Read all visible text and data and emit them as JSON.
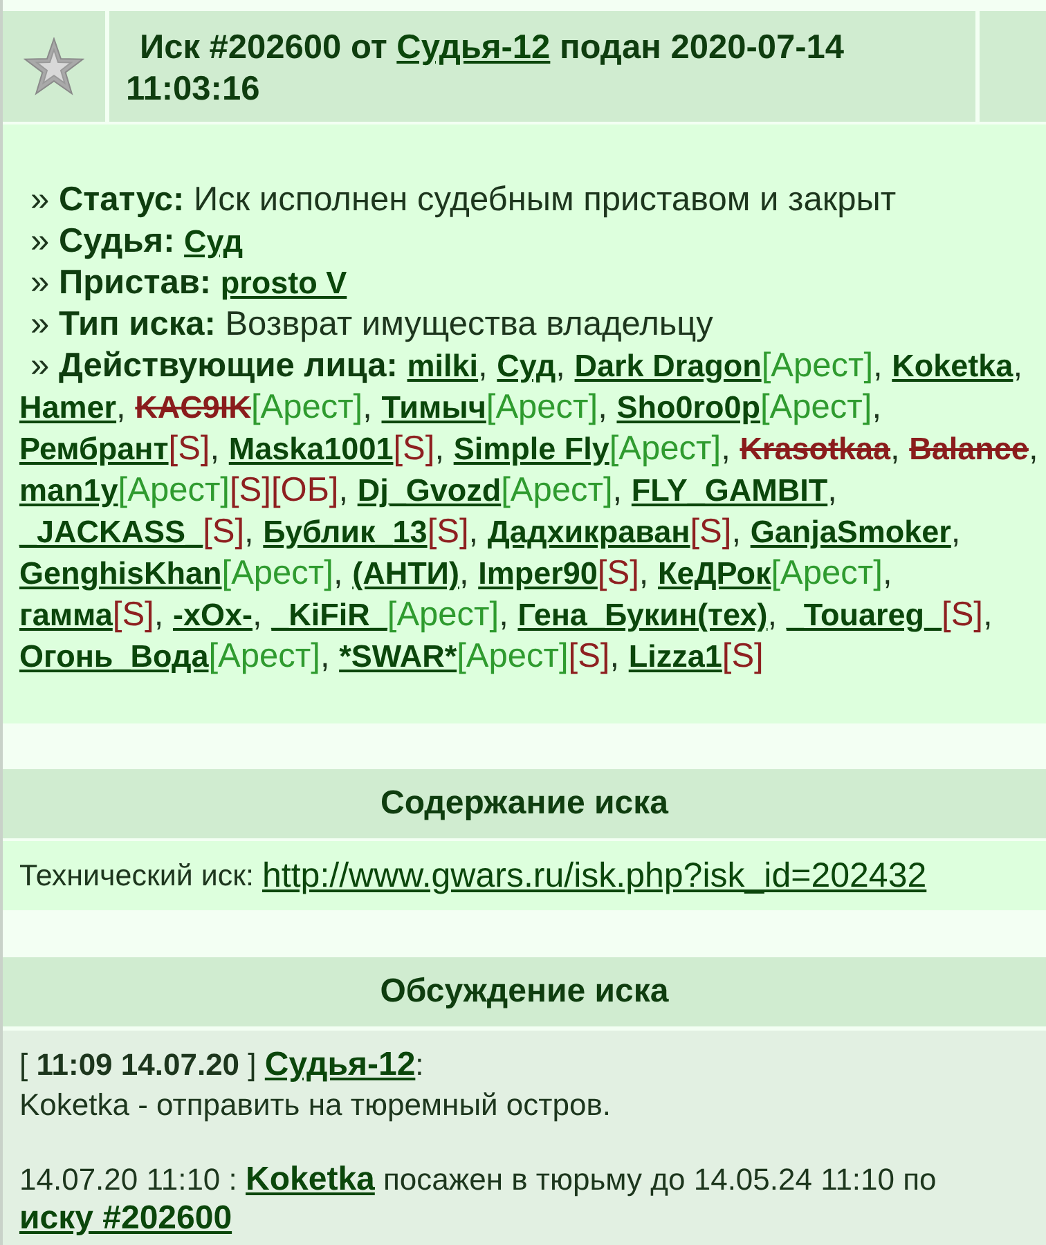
{
  "header": {
    "prefix": "Иск #202600 от",
    "author": "Судья-12",
    "suffix": "подан 2020-07-14 11:03:16"
  },
  "details": [
    {
      "bullet": "»",
      "label": "Статус:",
      "kind": "text",
      "value": "Иск исполнен судебным приставом и закрыт"
    },
    {
      "bullet": "»",
      "label": "Судья:",
      "kind": "link",
      "value": "Суд"
    },
    {
      "bullet": "»",
      "label": "Пристав:",
      "kind": "link",
      "value": "prosto V"
    },
    {
      "bullet": "»",
      "label": "Тип иска:",
      "kind": "text",
      "value": "Возврат имущества владельцу"
    }
  ],
  "participants": {
    "bullet": "»",
    "label": "Действующие лица:",
    "items": [
      {
        "name": "milki",
        "crossed_out": false,
        "punct": ","
      },
      {
        "name": "Суд",
        "crossed_out": false,
        "punct": ","
      },
      {
        "name": "Dark Dragon",
        "crossed_out": false,
        "tags": [
          {
            "text": "[Арест]",
            "kind": "arrest"
          }
        ],
        "punct": ","
      },
      {
        "name": "Koketka",
        "crossed_out": false,
        "punct": ","
      },
      {
        "name": "Hamer",
        "crossed_out": false,
        "punct": ","
      },
      {
        "name": "KAC9IK",
        "crossed_out": true,
        "tags": [
          {
            "text": "[Арест]",
            "kind": "arrest"
          }
        ],
        "punct": ","
      },
      {
        "name": "Тимыч",
        "crossed_out": false,
        "tags": [
          {
            "text": "[Арест]",
            "kind": "arrest"
          }
        ],
        "punct": ","
      },
      {
        "name": "Sho0ro0p",
        "crossed_out": false,
        "tags": [
          {
            "text": "[Арест]",
            "kind": "arrest"
          }
        ],
        "punct": ","
      },
      {
        "name": "Рембрант",
        "crossed_out": false,
        "tags": [
          {
            "text": "[S]",
            "kind": "flag"
          }
        ],
        "punct": ","
      },
      {
        "name": "Maska1001",
        "crossed_out": false,
        "tags": [
          {
            "text": "[S]",
            "kind": "flag"
          }
        ],
        "punct": ","
      },
      {
        "name": "Simple Fly",
        "crossed_out": false,
        "tags": [
          {
            "text": "[Арест]",
            "kind": "arrest"
          }
        ],
        "punct": ","
      },
      {
        "name": "Krasotkaa",
        "crossed_out": true,
        "punct": ","
      },
      {
        "name": "Balance",
        "crossed_out": true,
        "punct": ","
      },
      {
        "name": "man1y",
        "crossed_out": false,
        "tags": [
          {
            "text": "[Арест]",
            "kind": "arrest"
          },
          {
            "text": "[S]",
            "kind": "flag"
          },
          {
            "text": "[ОБ]",
            "kind": "flag"
          }
        ],
        "punct": ","
      },
      {
        "name": "Dj_Gvozd",
        "crossed_out": false,
        "tags": [
          {
            "text": "[Арест]",
            "kind": "arrest"
          }
        ],
        "punct": ","
      },
      {
        "name": "FLY_GAMBIT",
        "crossed_out": false,
        "punct": ","
      },
      {
        "name": "_JACKASS_",
        "crossed_out": false,
        "tags": [
          {
            "text": "[S]",
            "kind": "flag"
          }
        ],
        "punct": ","
      },
      {
        "name": "Бублик_13",
        "crossed_out": false,
        "tags": [
          {
            "text": "[S]",
            "kind": "flag"
          }
        ],
        "punct": ","
      },
      {
        "name": "Дадхикраван",
        "crossed_out": false,
        "tags": [
          {
            "text": "[S]",
            "kind": "flag"
          }
        ],
        "punct": ","
      },
      {
        "name": "GanjaSmoker",
        "crossed_out": false,
        "punct": ","
      },
      {
        "name": "GenghisKhan",
        "crossed_out": false,
        "tags": [
          {
            "text": "[Арест]",
            "kind": "arrest"
          }
        ],
        "punct": ","
      },
      {
        "name": "(АНТИ)",
        "crossed_out": false,
        "punct": ","
      },
      {
        "name": "Imper90",
        "crossed_out": false,
        "tags": [
          {
            "text": "[S]",
            "kind": "flag"
          }
        ],
        "punct": ","
      },
      {
        "name": "КеДРок",
        "crossed_out": false,
        "tags": [
          {
            "text": "[Арест]",
            "kind": "arrest"
          }
        ],
        "punct": ","
      },
      {
        "name": "гамма",
        "crossed_out": false,
        "tags": [
          {
            "text": "[S]",
            "kind": "flag"
          }
        ],
        "punct": ","
      },
      {
        "name": "-xOx-",
        "crossed_out": false,
        "punct": ","
      },
      {
        "name": "_KiFiR_",
        "crossed_out": false,
        "tags": [
          {
            "text": "[Арест]",
            "kind": "arrest"
          }
        ],
        "punct": ","
      },
      {
        "name": "Гена_Букин(тех)",
        "crossed_out": false,
        "punct": ","
      },
      {
        "name": "_Touareg_",
        "crossed_out": false,
        "tags": [
          {
            "text": "[S]",
            "kind": "flag"
          }
        ],
        "punct": ","
      },
      {
        "name": "Огонь_Вода",
        "crossed_out": false,
        "tags": [
          {
            "text": "[Арест]",
            "kind": "arrest"
          }
        ],
        "punct": ","
      },
      {
        "name": "*SWAR*",
        "crossed_out": false,
        "tags": [
          {
            "text": "[Арест]",
            "kind": "arrest"
          },
          {
            "text": "[S]",
            "kind": "flag"
          }
        ],
        "punct": ","
      },
      {
        "name": "Lizza1",
        "crossed_out": false,
        "tags": [
          {
            "text": "[S]",
            "kind": "flag"
          }
        ]
      }
    ]
  },
  "content": {
    "title": "Содержание иска",
    "label": "Технический иск:",
    "link": "http://www.gwars.ru/isk.php?isk_id=202432"
  },
  "discussion": {
    "title": "Обсуждение иска",
    "messages": [
      {
        "kind": "comment",
        "meta": "[ **11:09 14.07.20** ]",
        "author": "Судья-12",
        "after": ":",
        "text": "Koketka - отправить на тюремный остров."
      },
      {
        "kind": "event",
        "time": "14.07.20 11:10 :",
        "player": "Koketka",
        "text": "посажен в тюрьму до 14.05.24 11:10 по",
        "link": "иску #202600"
      }
    ]
  }
}
